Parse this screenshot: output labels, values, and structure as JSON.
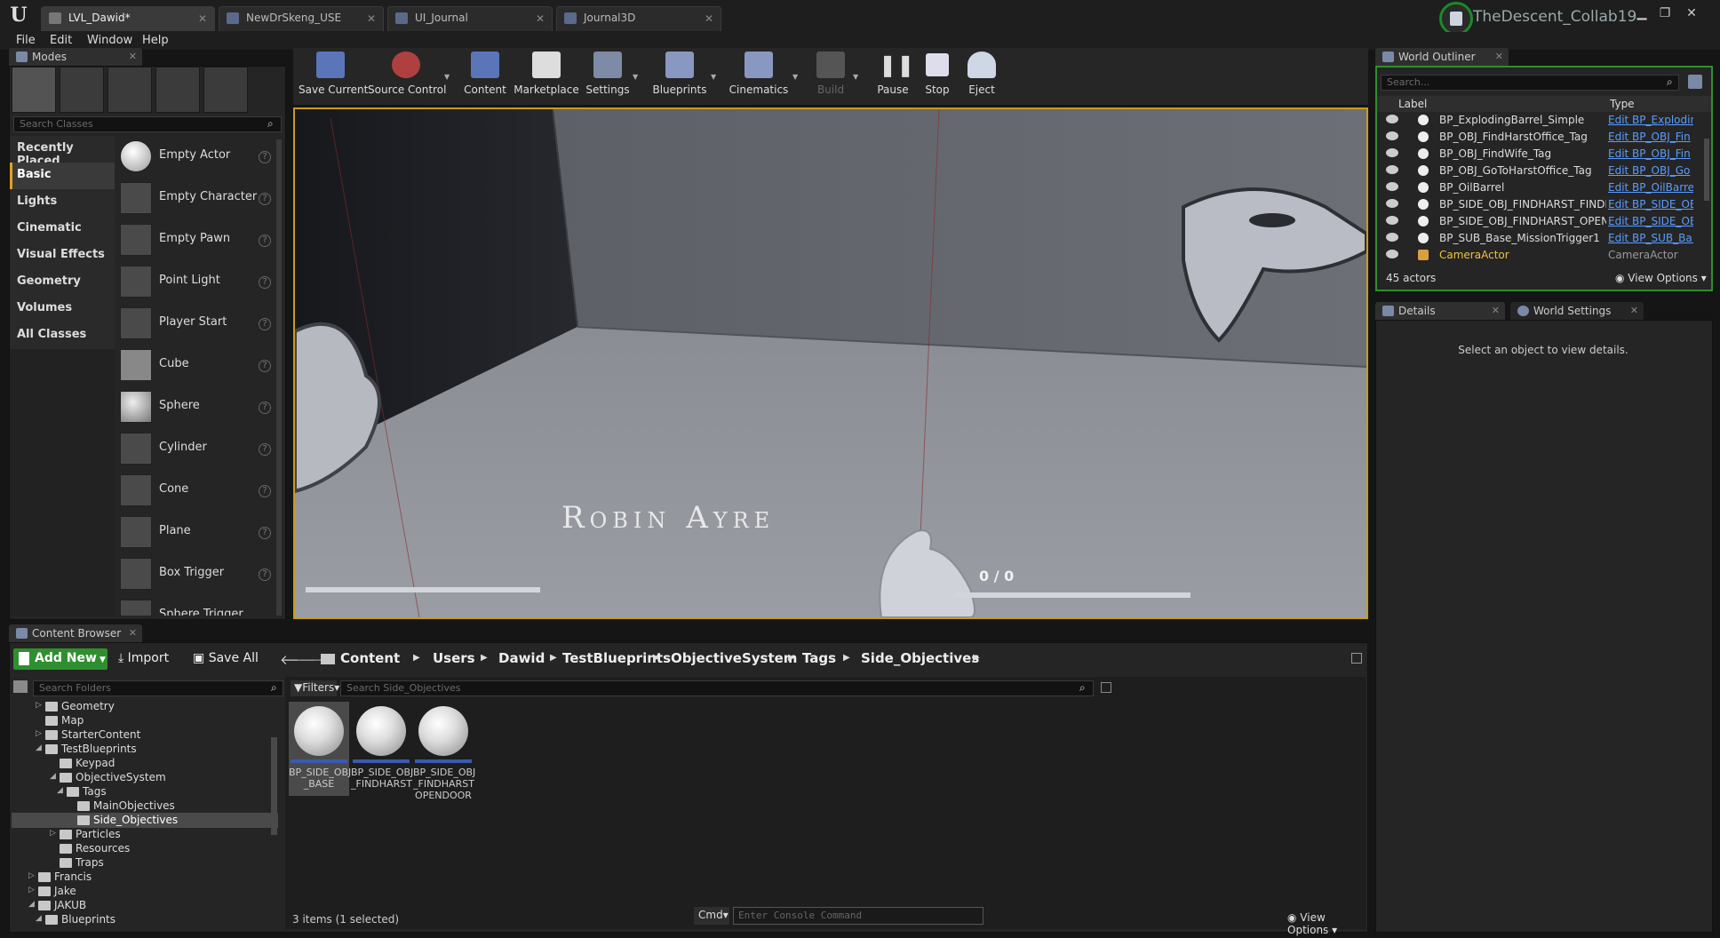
{
  "window": {
    "tabs": [
      {
        "label": "LVL_Dawid*",
        "active": true
      },
      {
        "label": "NewDrSkeng_USE",
        "active": false
      },
      {
        "label": "UI_Journal",
        "active": false
      },
      {
        "label": "Journal3D",
        "active": false
      }
    ],
    "project_name": "TheDescent_Collab19",
    "controls": [
      "▁",
      "❐",
      "✕"
    ]
  },
  "menu": [
    "File",
    "Edit",
    "Window",
    "Help"
  ],
  "modes": {
    "title": "Modes",
    "search_placeholder": "Search Classes",
    "categories": [
      "Recently Placed",
      "Basic",
      "Lights",
      "Cinematic",
      "Visual Effects",
      "Geometry",
      "Volumes",
      "All Classes"
    ],
    "active_category": "Basic",
    "actors": [
      "Empty Actor",
      "Empty Character",
      "Empty Pawn",
      "Point Light",
      "Player Start",
      "Cube",
      "Sphere",
      "Cylinder",
      "Cone",
      "Plane",
      "Box Trigger",
      "Sphere Trigger"
    ]
  },
  "toolbar": {
    "buttons": [
      "Save Current",
      "Source Control",
      "Content",
      "Marketplace",
      "Settings",
      "Blueprints",
      "Cinematics",
      "Build",
      "Pause",
      "Stop",
      "Eject"
    ]
  },
  "viewport": {
    "hud_name": "Robin Ayre",
    "hud_counter": "0 / 0"
  },
  "outliner": {
    "title": "World Outliner",
    "search_placeholder": "Search...",
    "col_label": "Label",
    "col_type": "Type",
    "rows": [
      {
        "name": "BP_ExplodingBarrel_Simple",
        "type": "Edit BP_Explodin"
      },
      {
        "name": "BP_OBJ_FindHarstOffice_Tag",
        "type": "Edit BP_OBJ_Fin"
      },
      {
        "name": "BP_OBJ_FindWife_Tag",
        "type": "Edit BP_OBJ_Fin"
      },
      {
        "name": "BP_OBJ_GoToHarstOffice_Tag",
        "type": "Edit BP_OBJ_Go"
      },
      {
        "name": "BP_OilBarrel",
        "type": "Edit BP_OilBarre"
      },
      {
        "name": "BP_SIDE_OBJ_FINDHARST_FINDP",
        "type": "Edit BP_SIDE_OE"
      },
      {
        "name": "BP_SIDE_OBJ_FINDHARST_OPEND",
        "type": "Edit BP_SIDE_OE"
      },
      {
        "name": "BP_SUB_Base_MissionTrigger1",
        "type": "Edit BP_SUB_Ba:"
      },
      {
        "name": "CameraActor",
        "type": "CameraActor"
      }
    ],
    "count": "45 actors",
    "view_options": "View Options"
  },
  "details": {
    "tab": "Details",
    "tab2": "World Settings",
    "empty_text": "Select an object to view details."
  },
  "content_browser": {
    "title": "Content Browser",
    "add_new": "Add New",
    "import": "Import",
    "save_all": "Save All",
    "breadcrumb": [
      "Content",
      "Users",
      "Dawid",
      "TestBlueprints",
      "ObjectiveSystem",
      "Tags",
      "Side_Objectives"
    ],
    "search_folders": "Search Folders",
    "filters": "Filters",
    "search_assets": "Search Side_Objectives",
    "folders": [
      {
        "name": "Geometry",
        "depth": 3,
        "arrow": "▷"
      },
      {
        "name": "Map",
        "depth": 3,
        "arrow": ""
      },
      {
        "name": "StarterContent",
        "depth": 3,
        "arrow": "▷"
      },
      {
        "name": "TestBlueprints",
        "depth": 3,
        "arrow": "◢"
      },
      {
        "name": "Keypad",
        "depth": 4,
        "arrow": ""
      },
      {
        "name": "ObjectiveSystem",
        "depth": 4,
        "arrow": "◢"
      },
      {
        "name": "Tags",
        "depth": 5,
        "arrow": "◢"
      },
      {
        "name": "MainObjectives",
        "depth": 6,
        "arrow": ""
      },
      {
        "name": "Side_Objectives",
        "depth": 6,
        "arrow": "",
        "selected": true
      },
      {
        "name": "Particles",
        "depth": 4,
        "arrow": "▷"
      },
      {
        "name": "Resources",
        "depth": 4,
        "arrow": ""
      },
      {
        "name": "Traps",
        "depth": 4,
        "arrow": ""
      },
      {
        "name": "Francis",
        "depth": 2,
        "arrow": "▷"
      },
      {
        "name": "Jake",
        "depth": 2,
        "arrow": "▷"
      },
      {
        "name": "JAKUB",
        "depth": 2,
        "arrow": "◢"
      },
      {
        "name": "Blueprints",
        "depth": 3,
        "arrow": "◢"
      }
    ],
    "assets": [
      {
        "name": "BP_SIDE_OBJ _BASE",
        "selected": true
      },
      {
        "name": "BP_SIDE_OBJ _FINDHARST",
        "selected": false
      },
      {
        "name": "BP_SIDE_OBJ _FINDHARST OPENDOOR",
        "selected": false
      }
    ],
    "status": "3 items (1 selected)",
    "cmd_label": "Cmd",
    "console_placeholder": "Enter Console Command",
    "view_options": "View Options"
  },
  "colors": {
    "accent_yellow": "#e0a020",
    "add_new_green": "#2f8f2f",
    "link_blue": "#5a9cff",
    "project_ring": "#1a8a2a"
  }
}
